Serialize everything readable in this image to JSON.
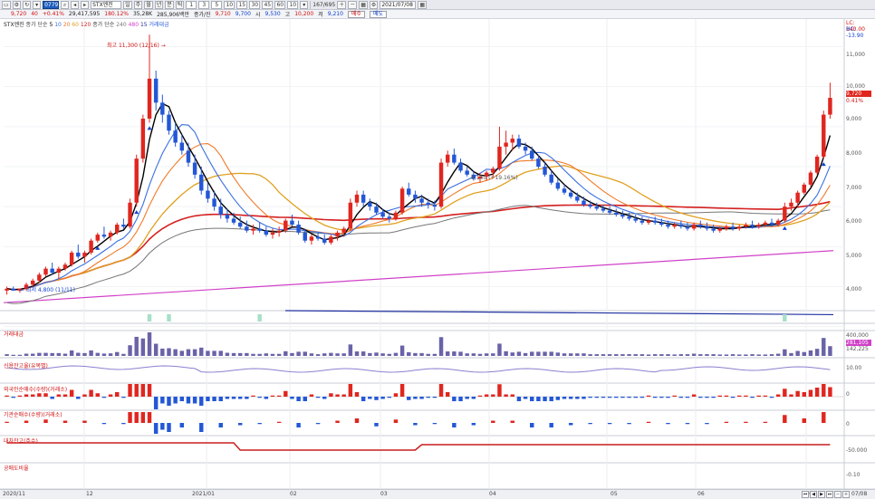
{
  "toolbar": {
    "code": "077970",
    "name": "STX엔진",
    "periods": [
      "1",
      "3",
      "5",
      "10",
      "15",
      "30",
      "45",
      "60"
    ],
    "count_value": "10",
    "display_range": "167/695",
    "date": "2021/07/08"
  },
  "info": {
    "price": "9,720",
    "change": "40",
    "change_pct": "+0.41%",
    "volume": "29,417,595",
    "vol_ratio": "180.12%",
    "turnover": "35,28K",
    "trade_amount": "285,906백만",
    "prev_label": "종가/진",
    "open_label": "시",
    "open_val": "9,530",
    "high_label": "고",
    "high_val": "10,200",
    "low_label": "저",
    "low_val": "9,210",
    "buy_label": "매수",
    "sell_label": "매도",
    "p1": "9,710",
    "p2": "9,700"
  },
  "legend": {
    "title": "STX엔진",
    "ma_prefix": "종가 단순",
    "ma_periods": [
      "5",
      "10",
      "20",
      "60",
      "120"
    ],
    "ma2_prefix": "종가 단순",
    "ma2_periods": [
      "240",
      "480"
    ],
    "ma2_extra": "15",
    "volume_label": "거래대금"
  },
  "annotations": {
    "high": "최고 11,300 (12/16) →",
    "low": "← 최저 4,800 (11/11)",
    "mid": "8,140 (+19.16%)"
  },
  "right_labels": {
    "lc": "LC: 140.00",
    "hc": "HC: -13.90",
    "last_price": "9,720",
    "last_pct": "0.41%",
    "vol_top": "400,000",
    "vol_last": "281,105",
    "vol_zero": "142,225",
    "credit": "10.00",
    "zero": "0",
    "minus50": "-50.000",
    "minus01": "-0.10"
  },
  "price_axis": [
    "11,000",
    "10,000",
    "9,000",
    "8,000",
    "7,000",
    "6,000",
    "5,000",
    "4,000"
  ],
  "panes": {
    "volume": "거래대금",
    "credit": "신용잔고율(유목별)",
    "foreign": "외국인순매수(수량)(거래소)",
    "institution": "기관순매수(수량)(거래소)",
    "retail": "대차잔고(주수)",
    "short": "공매도비율"
  },
  "x_axis": [
    "2020/11",
    "12",
    "2021/01",
    "02",
    "03",
    "04",
    "05",
    "06",
    "07"
  ],
  "bottom_right": "07/08",
  "colors": {
    "up": "#e0261f",
    "down": "#2357d6",
    "ma5": "#000000",
    "ma10": "#3a6fe0",
    "ma20": "#f07a2a",
    "ma60": "#e0a020",
    "ma120": "#d42020",
    "ma240": "#777777",
    "ma480": "#d040c8",
    "long": "#2030a0"
  },
  "chart_data": {
    "type": "candlestick",
    "title": "STX엔진",
    "ylim": [
      4400,
      11600
    ],
    "ohlc": [
      [
        4900,
        5000,
        4800,
        4950
      ],
      [
        4950,
        5000,
        4900,
        4900
      ],
      [
        4900,
        4950,
        4850,
        4950
      ],
      [
        4950,
        5100,
        4900,
        5050
      ],
      [
        5050,
        5200,
        5000,
        5150
      ],
      [
        5150,
        5350,
        5100,
        5300
      ],
      [
        5300,
        5500,
        5250,
        5450
      ],
      [
        5450,
        5600,
        5300,
        5350
      ],
      [
        5350,
        5500,
        5200,
        5450
      ],
      [
        5450,
        5600,
        5400,
        5550
      ],
      [
        5550,
        5900,
        5500,
        5850
      ],
      [
        5850,
        6050,
        5700,
        5750
      ],
      [
        5750,
        5900,
        5600,
        5850
      ],
      [
        5850,
        6200,
        5800,
        6150
      ],
      [
        6150,
        6350,
        6100,
        6300
      ],
      [
        6300,
        6500,
        6200,
        6250
      ],
      [
        6250,
        6400,
        6150,
        6350
      ],
      [
        6350,
        6600,
        6300,
        6550
      ],
      [
        6550,
        6700,
        6450,
        6500
      ],
      [
        6500,
        7200,
        6450,
        7100
      ],
      [
        7100,
        8300,
        7000,
        8200
      ],
      [
        8200,
        9300,
        8100,
        9200
      ],
      [
        9200,
        11300,
        9100,
        10200
      ],
      [
        10200,
        10400,
        9400,
        9600
      ],
      [
        9600,
        9800,
        9100,
        9300
      ],
      [
        9300,
        9400,
        8800,
        8900
      ],
      [
        8900,
        9100,
        8500,
        8600
      ],
      [
        8600,
        8800,
        8300,
        8400
      ],
      [
        8400,
        8600,
        8000,
        8100
      ],
      [
        8100,
        8300,
        7700,
        7800
      ],
      [
        7800,
        8000,
        7300,
        7400
      ],
      [
        7400,
        7600,
        7100,
        7200
      ],
      [
        7200,
        7400,
        6900,
        7000
      ],
      [
        7000,
        7200,
        6700,
        6800
      ],
      [
        6800,
        6950,
        6600,
        6700
      ],
      [
        6700,
        6850,
        6550,
        6600
      ],
      [
        6600,
        6750,
        6450,
        6500
      ],
      [
        6500,
        6650,
        6350,
        6400
      ],
      [
        6400,
        6550,
        6300,
        6450
      ],
      [
        6450,
        6600,
        6350,
        6400
      ],
      [
        6400,
        6500,
        6250,
        6300
      ],
      [
        6300,
        6450,
        6200,
        6350
      ],
      [
        6350,
        6500,
        6250,
        6400
      ],
      [
        6400,
        6700,
        6350,
        6650
      ],
      [
        6650,
        6800,
        6500,
        6550
      ],
      [
        6550,
        6650,
        6300,
        6350
      ],
      [
        6350,
        6450,
        6100,
        6150
      ],
      [
        6150,
        6300,
        6050,
        6250
      ],
      [
        6250,
        6350,
        6150,
        6200
      ],
      [
        6200,
        6300,
        6050,
        6100
      ],
      [
        6100,
        6300,
        6050,
        6250
      ],
      [
        6250,
        6400,
        6150,
        6350
      ],
      [
        6350,
        6500,
        6250,
        6450
      ],
      [
        6450,
        7200,
        6400,
        7100
      ],
      [
        7100,
        7400,
        7000,
        7300
      ],
      [
        7300,
        7400,
        7000,
        7100
      ],
      [
        7100,
        7200,
        6900,
        7000
      ],
      [
        7000,
        7100,
        6800,
        6850
      ],
      [
        6850,
        6950,
        6700,
        6750
      ],
      [
        6750,
        6850,
        6600,
        6700
      ],
      [
        6700,
        6900,
        6650,
        6850
      ],
      [
        6850,
        7500,
        6800,
        7450
      ],
      [
        7450,
        7600,
        7250,
        7300
      ],
      [
        7300,
        7400,
        7100,
        7200
      ],
      [
        7200,
        7300,
        7000,
        7100
      ],
      [
        7100,
        7200,
        6950,
        7050
      ],
      [
        7050,
        7150,
        6900,
        7000
      ],
      [
        7000,
        8200,
        6950,
        8100
      ],
      [
        8100,
        8400,
        8000,
        8300
      ],
      [
        8300,
        8450,
        8050,
        8100
      ],
      [
        8100,
        8200,
        7850,
        7900
      ],
      [
        7900,
        8000,
        7750,
        7800
      ],
      [
        7800,
        7900,
        7650,
        7700
      ],
      [
        7700,
        7850,
        7600,
        7750
      ],
      [
        7750,
        7900,
        7650,
        7850
      ],
      [
        7850,
        8000,
        7750,
        7950
      ],
      [
        7950,
        9000,
        7900,
        8500
      ],
      [
        8500,
        8900,
        8300,
        8600
      ],
      [
        8600,
        8800,
        8400,
        8700
      ],
      [
        8700,
        8800,
        8450,
        8500
      ],
      [
        8500,
        8600,
        8300,
        8400
      ],
      [
        8400,
        8500,
        8150,
        8200
      ],
      [
        8200,
        8300,
        7950,
        8000
      ],
      [
        8000,
        8100,
        7750,
        7800
      ],
      [
        7800,
        7900,
        7550,
        7600
      ],
      [
        7600,
        7700,
        7400,
        7450
      ],
      [
        7450,
        7550,
        7300,
        7350
      ],
      [
        7350,
        7450,
        7200,
        7250
      ],
      [
        7250,
        7350,
        7100,
        7150
      ],
      [
        7150,
        7250,
        7000,
        7050
      ],
      [
        7050,
        7150,
        6950,
        7000
      ],
      [
        7000,
        7100,
        6900,
        6950
      ],
      [
        6950,
        7050,
        6850,
        6900
      ],
      [
        6900,
        7000,
        6800,
        6850
      ],
      [
        6850,
        6950,
        6750,
        6800
      ],
      [
        6800,
        6900,
        6700,
        6750
      ],
      [
        6750,
        6850,
        6650,
        6700
      ],
      [
        6700,
        6800,
        6600,
        6650
      ],
      [
        6650,
        6750,
        6550,
        6600
      ],
      [
        6600,
        6700,
        6550,
        6650
      ],
      [
        6650,
        6750,
        6550,
        6600
      ],
      [
        6600,
        6700,
        6500,
        6550
      ],
      [
        6550,
        6650,
        6450,
        6500
      ],
      [
        6500,
        6600,
        6450,
        6550
      ],
      [
        6550,
        6650,
        6450,
        6500
      ],
      [
        6500,
        6600,
        6400,
        6450
      ],
      [
        6450,
        6600,
        6400,
        6550
      ],
      [
        6550,
        6650,
        6450,
        6500
      ],
      [
        6500,
        6600,
        6400,
        6450
      ],
      [
        6450,
        6550,
        6350,
        6400
      ],
      [
        6400,
        6500,
        6350,
        6450
      ],
      [
        6450,
        6550,
        6400,
        6500
      ],
      [
        6500,
        6600,
        6400,
        6450
      ],
      [
        6450,
        6550,
        6400,
        6500
      ],
      [
        6500,
        6600,
        6450,
        6550
      ],
      [
        6550,
        6650,
        6450,
        6500
      ],
      [
        6500,
        6600,
        6450,
        6550
      ],
      [
        6550,
        6650,
        6500,
        6600
      ],
      [
        6600,
        6700,
        6500,
        6550
      ],
      [
        6550,
        6700,
        6500,
        6650
      ],
      [
        6650,
        7100,
        6600,
        7000
      ],
      [
        7000,
        7200,
        6900,
        7100
      ],
      [
        7100,
        7400,
        7000,
        7350
      ],
      [
        7350,
        7600,
        7300,
        7550
      ],
      [
        7550,
        7900,
        7500,
        7850
      ],
      [
        7850,
        8300,
        7800,
        8250
      ],
      [
        8250,
        9400,
        8200,
        9300
      ],
      [
        9300,
        10100,
        9200,
        9720
      ]
    ],
    "series": [
      {
        "name": "5",
        "values": []
      },
      {
        "name": "10",
        "values": []
      },
      {
        "name": "20",
        "values": []
      },
      {
        "name": "60",
        "values": []
      },
      {
        "name": "120",
        "values": []
      },
      {
        "name": "240",
        "values": []
      },
      {
        "name": "480",
        "values": []
      }
    ]
  }
}
